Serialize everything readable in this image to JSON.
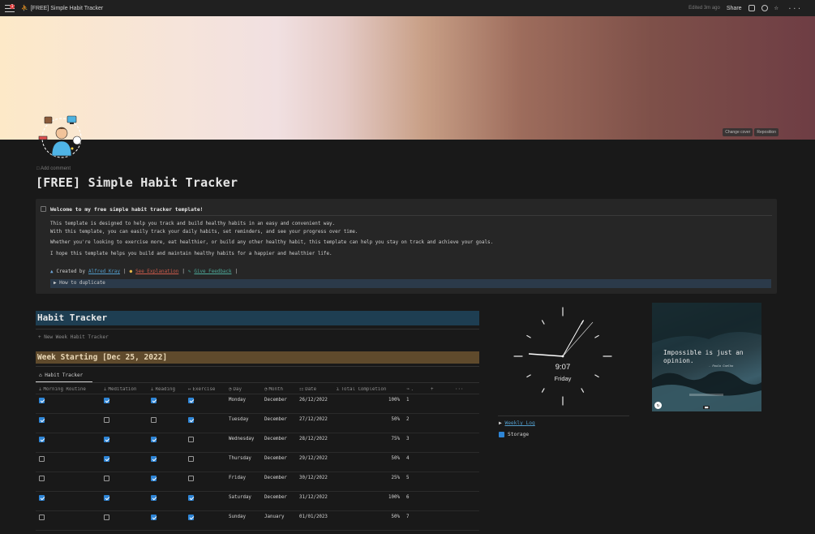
{
  "topbar": {
    "breadcrumb": "[FREE] Simple Habit Tracker",
    "notifications": "1",
    "edited": "Edited 3m ago",
    "share": "Share"
  },
  "cover": {
    "change": "Change cover",
    "reposition": "Reposition"
  },
  "page": {
    "add_comment": "Add comment",
    "title": "[FREE] Simple Habit Tracker"
  },
  "callout": {
    "heading": "Welcome to my free simple habit tracker template!",
    "p1": "This template is designed to help you track and build healthy habits in an easy and convenient way.",
    "p2": "With this template, you can easily track your daily habits, set reminders, and see your progress over time.",
    "p3": "Whether you're looking to exercise more, eat healthier, or build any other healthy habit, this template can help you stay on track and achieve your goals.",
    "p4": "I hope this template helps you build and maintain healthy habits for a happier and healthier life.",
    "created_by": "Created by",
    "author": "Alfred Kray",
    "sep": "|",
    "explanation": "See Explanation",
    "feedback": "Give Feedback",
    "toggle": "How to duplicate"
  },
  "tracker": {
    "heading": "Habit Tracker",
    "new_week": "New Week Habit Tracker",
    "week_heading": "Week Starting [Dec 25, 2022]",
    "view_tab": "Habit Tracker",
    "columns": [
      "Morning Routine",
      "Meditation",
      "Reading",
      "Exercise",
      "Day",
      "Month",
      "Date",
      "Total Completion",
      "."
    ],
    "rows": [
      {
        "morning": true,
        "meditation": true,
        "reading": true,
        "exercise": true,
        "day": "Monday",
        "month": "December",
        "date": "26/12/2022",
        "total": "100%",
        "n": "1"
      },
      {
        "morning": true,
        "meditation": false,
        "reading": false,
        "exercise": true,
        "day": "Tuesday",
        "month": "December",
        "date": "27/12/2022",
        "total": "50%",
        "n": "2"
      },
      {
        "morning": true,
        "meditation": true,
        "reading": true,
        "exercise": false,
        "day": "Wednesday",
        "month": "December",
        "date": "28/12/2022",
        "total": "75%",
        "n": "3"
      },
      {
        "morning": false,
        "meditation": true,
        "reading": true,
        "exercise": false,
        "day": "Thursday",
        "month": "December",
        "date": "29/12/2022",
        "total": "50%",
        "n": "4"
      },
      {
        "morning": false,
        "meditation": false,
        "reading": true,
        "exercise": false,
        "day": "Friday",
        "month": "December",
        "date": "30/12/2022",
        "total": "25%",
        "n": "5"
      },
      {
        "morning": true,
        "meditation": true,
        "reading": true,
        "exercise": true,
        "day": "Saturday",
        "month": "December",
        "date": "31/12/2022",
        "total": "100%",
        "n": "6"
      },
      {
        "morning": false,
        "meditation": false,
        "reading": true,
        "exercise": true,
        "day": "Sunday",
        "month": "January",
        "date": "01/01/2023",
        "total": "50%",
        "n": "7"
      }
    ]
  },
  "clock": {
    "time": "9:07",
    "day": "Friday"
  },
  "quote": {
    "text": "Impossible is just an opinion.",
    "author": "- Paulo Coelho"
  },
  "side": {
    "weekly_log": "Weekly Log",
    "storage": "Storage"
  },
  "colors": {
    "accent": "#2e85d6",
    "tracker_heading": "#1e3e52",
    "week_heading": "#5f4a2c"
  }
}
